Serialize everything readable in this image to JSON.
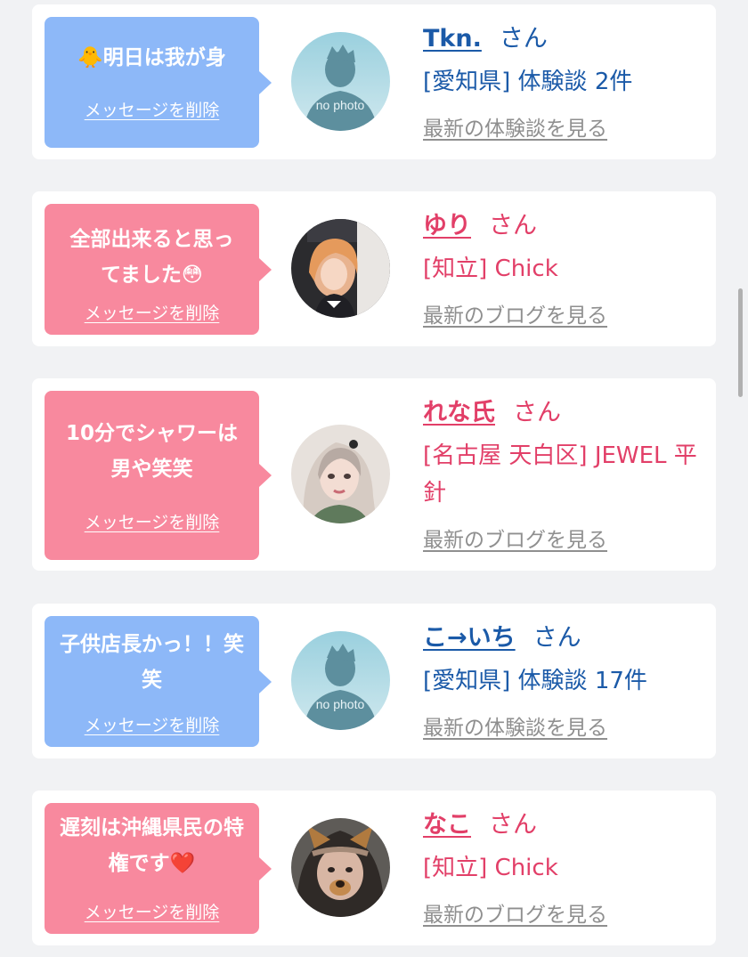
{
  "colors": {
    "bubble_blue": "#8db8f8",
    "bubble_pink": "#f8899e",
    "name_blue": "#1b5aa8",
    "name_pink": "#e23f68",
    "link_gray": "#8f8f8f"
  },
  "messages": [
    {
      "text": "🐥明日は我が身",
      "delete_label": "メッセージを削除",
      "bubble_color": "blue",
      "avatar": "no-photo",
      "no_photo_label": "no photo",
      "name": "Tkn.",
      "honorific": "さん",
      "detail": "[愛知県] 体験談 2件",
      "link": "最新の体験談を見る"
    },
    {
      "text": "全部出来ると思ってました😳",
      "delete_label": "メッセージを削除",
      "bubble_color": "pink",
      "avatar": "photo",
      "name": "ゆり",
      "honorific": "さん",
      "detail": "[知立] Chick",
      "link": "最新のブログを見る"
    },
    {
      "text": "10分でシャワーは男や笑笑",
      "delete_label": "メッセージを削除",
      "bubble_color": "pink",
      "avatar": "photo",
      "name": "れな氏",
      "honorific": "さん",
      "detail": "[名古屋 天白区] JEWEL 平針",
      "link": "最新のブログを見る"
    },
    {
      "text": "子供店長かっ！！笑笑",
      "delete_label": "メッセージを削除",
      "bubble_color": "blue",
      "avatar": "no-photo",
      "no_photo_label": "no photo",
      "name": "こ→いち",
      "honorific": "さん",
      "detail": "[愛知県] 体験談 17件",
      "link": "最新の体験談を見る"
    },
    {
      "text": "遅刻は沖縄県民の特権です❤️",
      "delete_label": "メッセージを削除",
      "bubble_color": "pink",
      "avatar": "photo",
      "name": "なこ",
      "honorific": "さん",
      "detail": "[知立] Chick",
      "link": "最新のブログを見る"
    }
  ]
}
